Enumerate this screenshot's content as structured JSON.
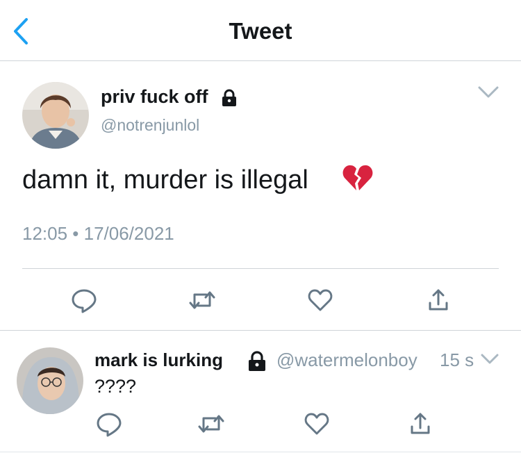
{
  "header": {
    "title": "Tweet",
    "back_icon": "chevron-left-icon"
  },
  "tweet": {
    "display_name": "priv fuck off",
    "handle": "@notrenjunlol",
    "text": "damn it, murder is illegal",
    "emoji": "broken-heart",
    "timestamp": "12:05 • 17/06/2021",
    "protected": true
  },
  "reply": {
    "display_name": "mark is lurking",
    "handle": "@watermelonboy",
    "time": "15 s",
    "text": "????",
    "protected": true
  },
  "actions": [
    "reply-icon",
    "retweet-icon",
    "like-icon",
    "share-icon"
  ],
  "colors": {
    "accent": "#1da1f2",
    "text": "#14171a",
    "secondary": "#8899a6",
    "icon": "#657786",
    "divider": "#cfd4d8",
    "broken_heart": "#d8233f"
  }
}
